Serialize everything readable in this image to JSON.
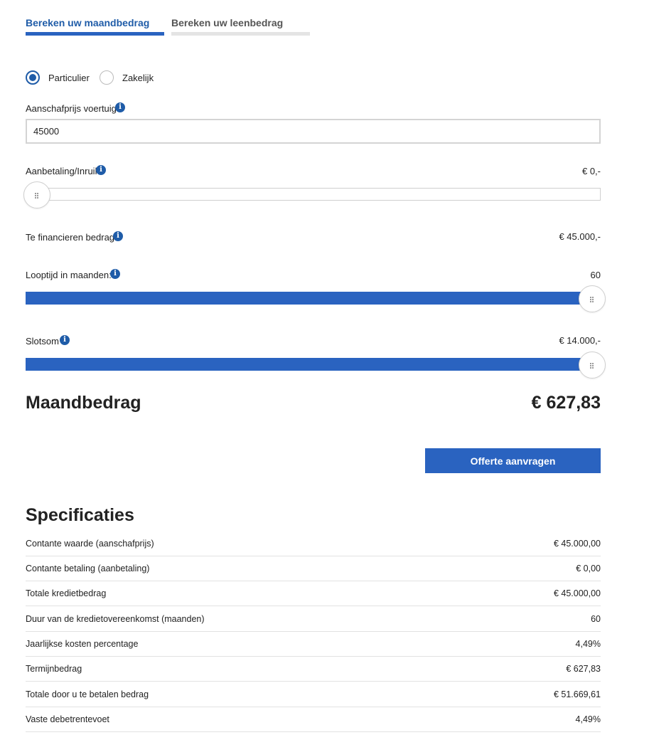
{
  "tabs": [
    {
      "label": "Bereken uw maandbedrag",
      "active": true
    },
    {
      "label": "Bereken uw leenbedrag",
      "active": false
    }
  ],
  "customer_type": {
    "options": [
      "Particulier",
      "Zakelijk"
    ],
    "selected": "Particulier"
  },
  "purchase_price": {
    "label": "Aanschafprijs voertuig",
    "value": "45000"
  },
  "down_payment": {
    "label": "Aanbetaling/Inruil",
    "value": "€ 0,-",
    "slider_fraction": 0
  },
  "financed_amount": {
    "label": "Te financieren bedrag",
    "value": "€ 45.000,-"
  },
  "term": {
    "label": "Looptijd in maanden:",
    "value": "60",
    "slider_fraction": 1
  },
  "final_payment": {
    "label": "Slotsom",
    "value": "€ 14.000,-",
    "slider_fraction": 1
  },
  "monthly": {
    "label": "Maandbedrag",
    "value": "€ 627,83"
  },
  "cta": {
    "label": "Offerte aanvragen"
  },
  "specs": {
    "title": "Specificaties",
    "rows": [
      {
        "label": "Contante waarde (aanschafprijs)",
        "value": "€ 45.000,00"
      },
      {
        "label": "Contante betaling (aanbetaling)",
        "value": "€ 0,00"
      },
      {
        "label": "Totale kredietbedrag",
        "value": "€ 45.000,00"
      },
      {
        "label": "Duur van de kredietovereenkomst (maanden)",
        "value": "60"
      },
      {
        "label": "Jaarlijkse kosten percentage",
        "value": "4,49%"
      },
      {
        "label": "Termijnbedrag",
        "value": "€ 627,83"
      },
      {
        "label": "Totale door u te betalen bedrag",
        "value": "€ 51.669,61"
      },
      {
        "label": "Vaste debetrentevoet",
        "value": "4,49%"
      }
    ]
  },
  "colors": {
    "accent": "#2a63c0",
    "tab_active_text": "#1f5ca8",
    "info_icon": "#1f5ca8"
  },
  "icons": {
    "info": "info-icon",
    "slider_grip": "grip-icon"
  }
}
